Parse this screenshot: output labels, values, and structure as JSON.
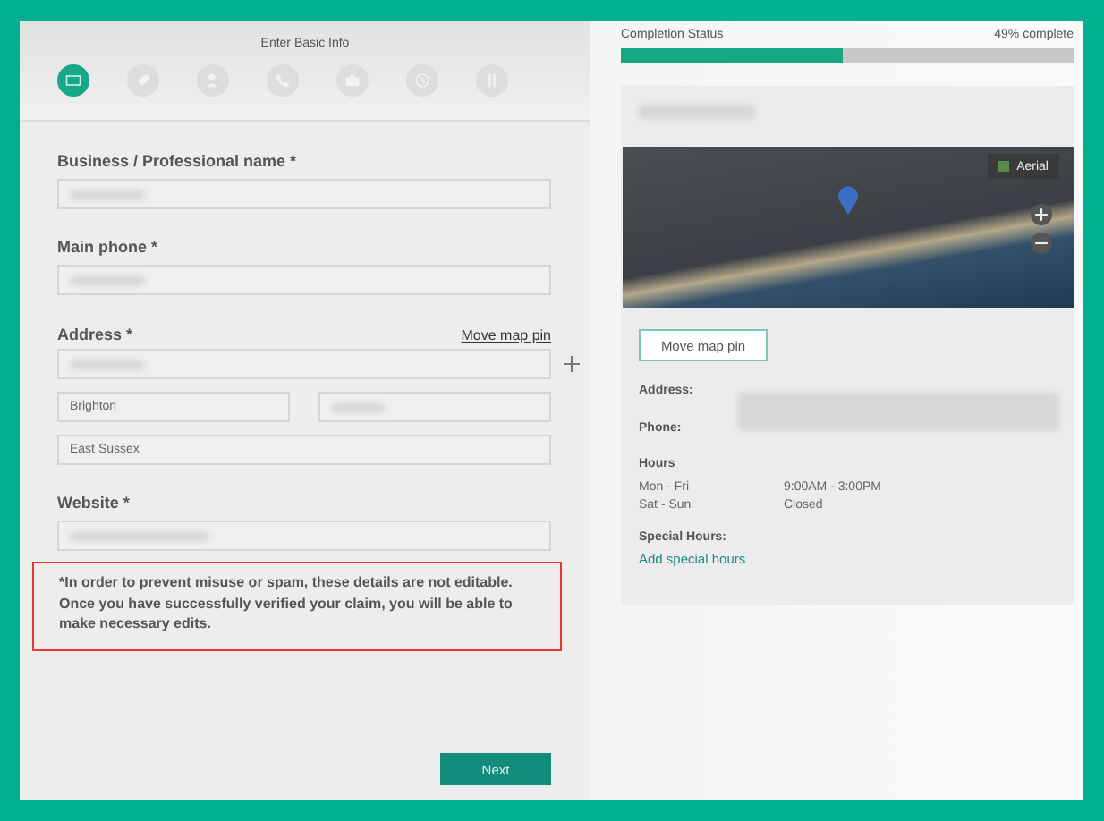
{
  "header": {
    "title": "Enter Basic Info"
  },
  "steps": [
    {
      "kind": "card",
      "selected": true
    },
    {
      "kind": "tag",
      "selected": false
    },
    {
      "kind": "person",
      "selected": false
    },
    {
      "kind": "phone",
      "selected": false
    },
    {
      "kind": "camera",
      "selected": false
    },
    {
      "kind": "clock",
      "selected": false
    },
    {
      "kind": "utensils",
      "selected": false
    }
  ],
  "form": {
    "name": {
      "label": "Business / Professional name *",
      "kind": "redacted"
    },
    "phone": {
      "label": "Main phone *",
      "kind": "redacted"
    },
    "address": {
      "label": "Address *",
      "link": "Move map pin",
      "lines": [
        {
          "kind": "redacted"
        }
      ],
      "row": [
        {
          "kind": "text",
          "value": "Brighton"
        },
        {
          "kind": "redacted"
        }
      ],
      "county": {
        "kind": "text",
        "value": "East Sussex"
      }
    },
    "website": {
      "label": "Website *",
      "kind": "redacted"
    },
    "notice": "*In order to prevent misuse or spam, these details are not editable. Once you have successfully verified your claim, you will be able to make necessary edits.",
    "next": "Next"
  },
  "completion": {
    "label": "Completion Status",
    "reading": "49% complete",
    "level": 0.49
  },
  "preview": {
    "map": {
      "aerial": "Aerial"
    },
    "move_pin": "Move map pin",
    "details": [
      {
        "label": "Address:"
      },
      {
        "label": "Phone:"
      }
    ],
    "hours": {
      "title": "Hours",
      "rows": [
        {
          "days": "Mon - Fri",
          "time": "9:00AM - 3:00PM"
        },
        {
          "days": "Sat - Sun",
          "time": "Closed"
        }
      ]
    },
    "special": {
      "title": "Special Hours:",
      "link": "Add special hours"
    }
  }
}
